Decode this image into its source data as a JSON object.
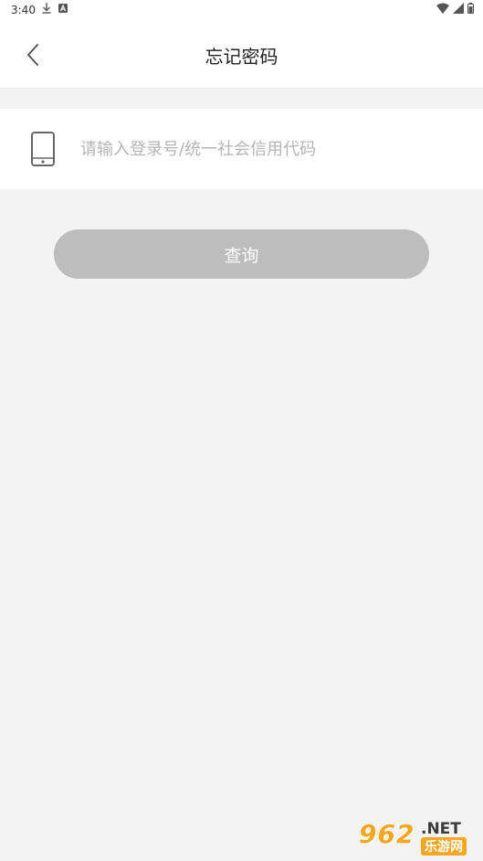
{
  "status_bar": {
    "time": "3:40"
  },
  "header": {
    "title": "忘记密码"
  },
  "form": {
    "input_placeholder": "请输入登录号/统一社会信用代码",
    "input_value": "",
    "query_label": "查询"
  },
  "watermark": {
    "number": "962",
    "net": ".NET",
    "cn": "乐游网"
  },
  "colors": {
    "background": "#f3f3f3",
    "button": "#bdbdbd",
    "placeholder": "#b5b5b5",
    "watermark_orange": "#f5a623"
  }
}
